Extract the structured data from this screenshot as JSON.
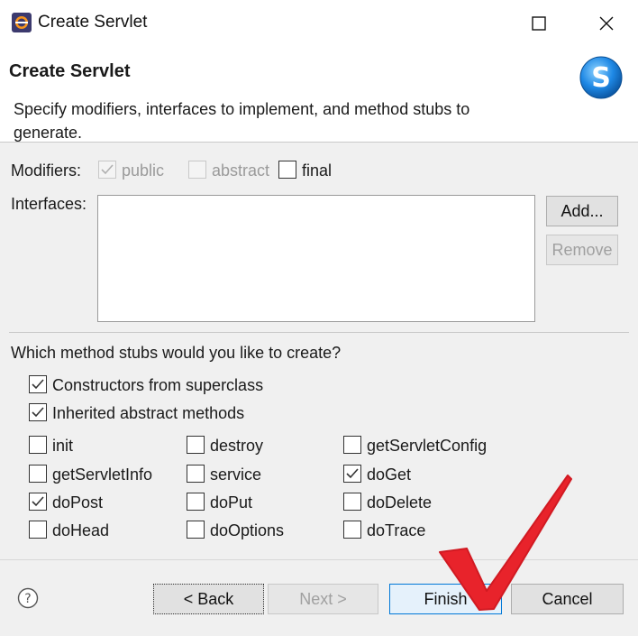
{
  "window": {
    "title": "Create Servlet"
  },
  "header": {
    "title": "Create Servlet",
    "description": "Specify modifiers, interfaces to implement, and method stubs to generate."
  },
  "modifiers": {
    "label": "Modifiers:",
    "public": {
      "label": "public",
      "checked": true,
      "enabled": false
    },
    "abstract": {
      "label": "abstract",
      "checked": false,
      "enabled": false
    },
    "final": {
      "label": "final",
      "checked": false,
      "enabled": true
    }
  },
  "interfaces": {
    "label": "Interfaces:",
    "add_label": "Add...",
    "remove_label": "Remove"
  },
  "stubs": {
    "question": "Which method stubs would you like to create?",
    "constructors": {
      "label": "Constructors from superclass",
      "checked": true
    },
    "inherited": {
      "label": "Inherited abstract methods",
      "checked": true
    },
    "methods": [
      {
        "label": "init",
        "checked": false
      },
      {
        "label": "destroy",
        "checked": false
      },
      {
        "label": "getServletConfig",
        "checked": false
      },
      {
        "label": "getServletInfo",
        "checked": false
      },
      {
        "label": "service",
        "checked": false
      },
      {
        "label": "doGet",
        "checked": true
      },
      {
        "label": "doPost",
        "checked": true
      },
      {
        "label": "doPut",
        "checked": false
      },
      {
        "label": "doDelete",
        "checked": false
      },
      {
        "label": "doHead",
        "checked": false
      },
      {
        "label": "doOptions",
        "checked": false
      },
      {
        "label": "doTrace",
        "checked": false
      }
    ]
  },
  "footer": {
    "back_label": "< Back",
    "next_label": "Next >",
    "finish_label": "Finish",
    "cancel_label": "Cancel"
  },
  "colors": {
    "annotation_check": "#e8232b",
    "finish_border": "#0078d7",
    "checkmark": "#333333"
  },
  "icons": {
    "app": "eclipse-icon",
    "banner": "servlet-s-icon",
    "help": "help-icon"
  }
}
